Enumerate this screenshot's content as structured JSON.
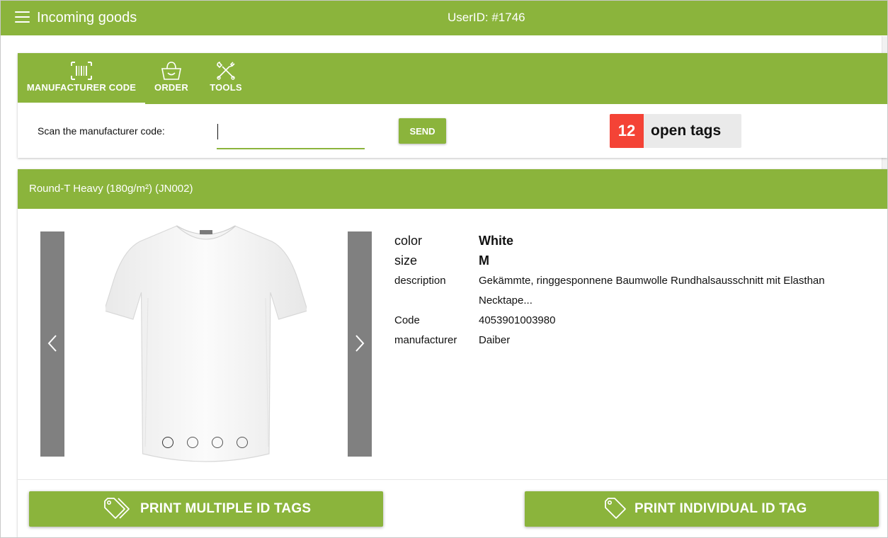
{
  "header": {
    "title": "Incoming goods",
    "user_id": "UserID: #1746",
    "menu_icon": "hamburger-menu-icon"
  },
  "tabs": [
    {
      "label": "MANUFACTURER CODE",
      "icon": "barcode-icon",
      "active": true
    },
    {
      "label": "ORDER",
      "icon": "shopping-basket-icon",
      "active": false
    },
    {
      "label": "TOOLS",
      "icon": "tools-icon",
      "active": false
    }
  ],
  "scan": {
    "label": "Scan the manufacturer code:",
    "value": "",
    "placeholder": "",
    "send_label": "SEND"
  },
  "tags": {
    "count": "12",
    "label": "open tags"
  },
  "product": {
    "title": "Round-T Heavy (180g/m²) (JN002)",
    "image_icon": "white-tshirt-image",
    "carousel_dots": 4,
    "specs": {
      "color_key": "color",
      "color_val": "White",
      "size_key": "size",
      "size_val": "M",
      "description_key": "description",
      "description_val": "Gekämmte, ringgesponnene Baumwolle Rundhalsausschnitt mit Elasthan Necktape...",
      "code_key": "Code",
      "code_val": "4053901003980",
      "manufacturer_key": "manufacturer",
      "manufacturer_val": "Daiber"
    }
  },
  "actions": {
    "print_multiple": "PRINT MULTIPLE ID TAGS",
    "print_individual": "PRINT INDIVIDUAL ID TAG",
    "icon": "tags-icon"
  },
  "colors": {
    "accent": "#8bb43c",
    "badge_red": "#f44336",
    "carousel_gray": "#808080"
  }
}
